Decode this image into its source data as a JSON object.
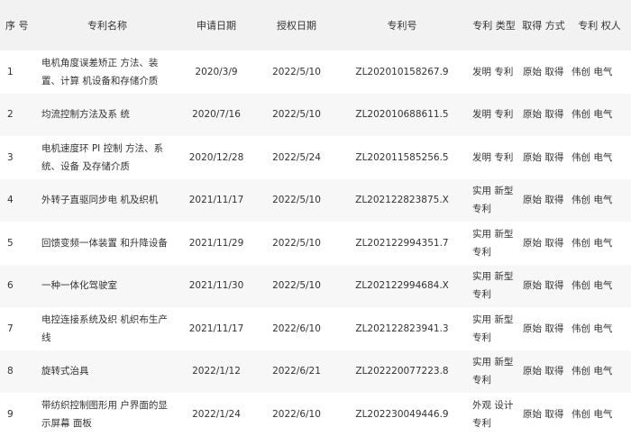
{
  "table": {
    "headers": [
      "序 号",
      "专利名称",
      "申请日期",
      "授权日期",
      "专利号",
      "专利 类型",
      "取得 方式",
      "专利 权人"
    ],
    "rows": [
      {
        "no": "1",
        "name": "电机角度误差矫正 方法、装置、计算 机设备和存储介质",
        "apply": "2020/3/9",
        "grant": "2022/5/10",
        "num": "ZL202010158267.9",
        "type": "发明 专利",
        "method": "原始 取得",
        "owner": "伟创 电气"
      },
      {
        "no": "2",
        "name": "均流控制方法及系 统",
        "apply": "2020/7/16",
        "grant": "2022/5/10",
        "num": "ZL202010688611.5",
        "type": "发明 专利",
        "method": "原始 取得",
        "owner": "伟创 电气"
      },
      {
        "no": "3",
        "name": "电机速度环 PI 控制 方法、系统、设备 及存储介质",
        "apply": "2020/12/28",
        "grant": "2022/5/24",
        "num": "ZL202011585256.5",
        "type": "发明 专利",
        "method": "原始 取得",
        "owner": "伟创 电气"
      },
      {
        "no": "4",
        "name": "外转子直驱同步电 机及织机",
        "apply": "2021/11/17",
        "grant": "2022/5/10",
        "num": "ZL202122823875.X",
        "type": "实用 新型 专利",
        "method": "原始 取得",
        "owner": "伟创 电气"
      },
      {
        "no": "5",
        "name": "回馈变频一体装置 和升降设备",
        "apply": "2021/11/29",
        "grant": "2022/5/10",
        "num": "ZL202122994351.7",
        "type": "实用 新型 专利",
        "method": "原始 取得",
        "owner": "伟创 电气"
      },
      {
        "no": "6",
        "name": "一种一体化驾驶室",
        "apply": "2021/11/30",
        "grant": "2022/5/10",
        "num": "ZL202122994684.X",
        "type": "实用 新型 专利",
        "method": "原始 取得",
        "owner": "伟创 电气"
      },
      {
        "no": "7",
        "name": "电控连接系统及织 机织布生产线",
        "apply": "2021/11/17",
        "grant": "2022/6/10",
        "num": "ZL202122823941.3",
        "type": "实用 新型 专利",
        "method": "原始 取得",
        "owner": "伟创 电气"
      },
      {
        "no": "8",
        "name": "旋转式治具",
        "apply": "2022/1/12",
        "grant": "2022/6/21",
        "num": "ZL202220077223.8",
        "type": "实用 新型 专利",
        "method": "原始 取得",
        "owner": "伟创 电气"
      },
      {
        "no": "9",
        "name": "带纺织控制图形用 户界面的显示屏幕 面板",
        "apply": "2022/1/24",
        "grant": "2022/6/10",
        "num": "ZL202230049446.9",
        "type": "外观 设计 专利",
        "method": "原始 取得",
        "owner": "伟创 电气"
      }
    ]
  }
}
